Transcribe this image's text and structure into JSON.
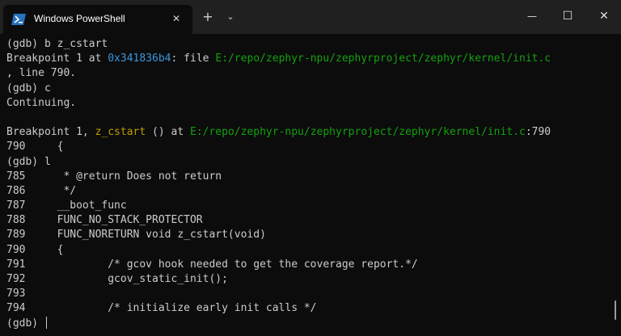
{
  "window": {
    "tab_title": "Windows PowerShell",
    "tab_icon": "powershell-icon",
    "controls": {
      "close_tab": "✕",
      "new_tab": "+",
      "dropdown": "⌄",
      "minimize": "—",
      "maximize": "☐",
      "close": "✕"
    }
  },
  "colors": {
    "background": "#0c0c0c",
    "text": "#cccccc",
    "address": "#3a96dd",
    "path": "#13a10e",
    "function": "#c19c00"
  },
  "terminal": {
    "l1": "(gdb) b z_cstart",
    "l2_a": "Breakpoint 1 at ",
    "l2_addr": "0x341836b4",
    "l2_b": ": file ",
    "l2_path": "E:/repo/zephyr-npu/zephyrproject/zephyr/kernel/init.c",
    "l3": ", line 790.",
    "l4": "(gdb) c",
    "l5": "Continuing.",
    "l6": "",
    "l7_a": "Breakpoint 1, ",
    "l7_func": "z_cstart",
    "l7_b": " () at ",
    "l7_path": "E:/repo/zephyr-npu/zephyrproject/zephyr/kernel/init.c",
    "l7_c": ":790",
    "l8": "790     {",
    "l9": "(gdb) l",
    "l10": "785      * @return Does not return",
    "l11": "786      */",
    "l12": "787     __boot_func",
    "l13": "788     FUNC_NO_STACK_PROTECTOR",
    "l14": "789     FUNC_NORETURN void z_cstart(void)",
    "l15": "790     {",
    "l16": "791             /* gcov hook needed to get the coverage report.*/",
    "l17": "792             gcov_static_init();",
    "l18": "793",
    "l19": "794             /* initialize early init calls */",
    "l20": "(gdb) "
  }
}
